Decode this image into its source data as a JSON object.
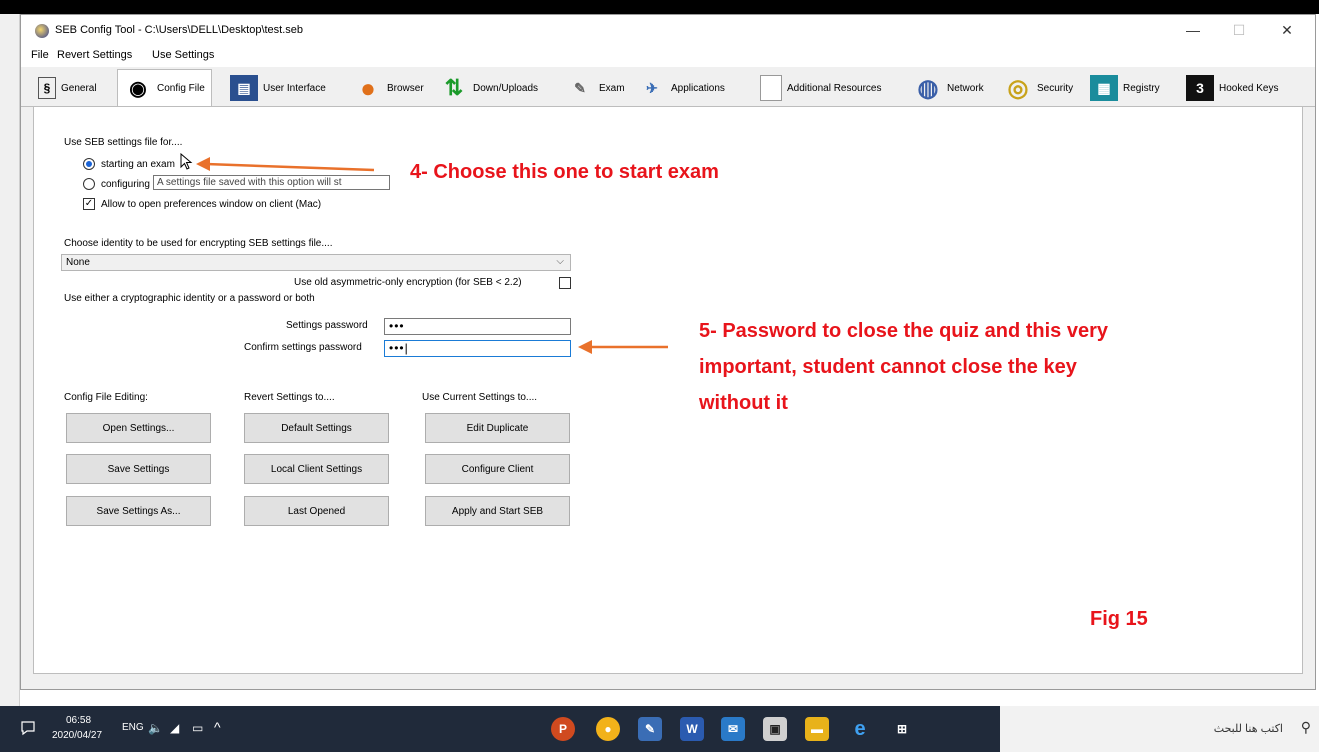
{
  "window": {
    "title": "SEB Config Tool - C:\\Users\\DELL\\Desktop\\test.seb",
    "min": "—",
    "max": "☐",
    "close": "✕"
  },
  "menu": [
    "File",
    "Revert Settings",
    "Use Settings"
  ],
  "tabs": [
    {
      "label": "General",
      "icon": "general-icon",
      "glyph": "§"
    },
    {
      "label": "Config File",
      "icon": "config-file-icon",
      "glyph": "◉"
    },
    {
      "label": "User Interface",
      "icon": "user-interface-icon",
      "glyph": "▤"
    },
    {
      "label": "Browser",
      "icon": "browser-icon",
      "glyph": "●"
    },
    {
      "label": "Down/Uploads",
      "icon": "down-uploads-icon",
      "glyph": "⇅"
    },
    {
      "label": "Exam",
      "icon": "exam-icon",
      "glyph": "✎"
    },
    {
      "label": "Applications",
      "icon": "applications-icon",
      "glyph": "✈"
    },
    {
      "label": "Additional Resources",
      "icon": "additional-resources-icon",
      "glyph": "▯"
    },
    {
      "label": "Network",
      "icon": "network-icon",
      "glyph": "◍"
    },
    {
      "label": "Security",
      "icon": "security-icon",
      "glyph": "◎"
    },
    {
      "label": "Registry",
      "icon": "registry-icon",
      "glyph": "▦"
    },
    {
      "label": "Hooked Keys",
      "icon": "hooked-keys-icon",
      "glyph": "3"
    }
  ],
  "config": {
    "use_for_label": "Use SEB settings file for....",
    "radio_exam": "starting an exam",
    "radio_config": "configuring",
    "tooltip": "A settings file saved with this option will st",
    "allow_prefs": "Allow to open preferences window on client (Mac)",
    "identity_label": "Choose identity to be used for encrypting SEB settings file....",
    "identity_value": "None",
    "old_encryption": "Use old asymmetric-only encryption (for SEB < 2.2)",
    "either_label": "Use either a cryptographic identity or a password or both",
    "settings_password_label": "Settings password",
    "settings_password_value": "•••",
    "confirm_password_label": "Confirm settings password",
    "confirm_password_value": "•••|"
  },
  "groups": {
    "editing": "Config File Editing:",
    "revert": "Revert Settings to....",
    "current": "Use Current Settings to...."
  },
  "buttons": {
    "open": "Open Settings...",
    "save": "Save Settings",
    "save_as": "Save Settings As...",
    "default": "Default Settings",
    "local_client": "Local Client Settings",
    "last_opened": "Last Opened",
    "edit_duplicate": "Edit Duplicate",
    "configure_client": "Configure Client",
    "apply_start": "Apply and Start SEB"
  },
  "annotations": {
    "step4": "4- Choose this  one to start exam",
    "step5_line1": "5- Password to close the quiz and this very",
    "step5_line2": "important, student cannot close the key",
    "step5_line3": "without it",
    "fig": "Fig 15",
    "arrow_color": "#e9712b",
    "text_color": "#e8141b"
  },
  "taskbar": {
    "time": "06:58",
    "date": "2020/04/27",
    "lang": "ENG",
    "search_placeholder": "اكتب هنا للبحث"
  }
}
